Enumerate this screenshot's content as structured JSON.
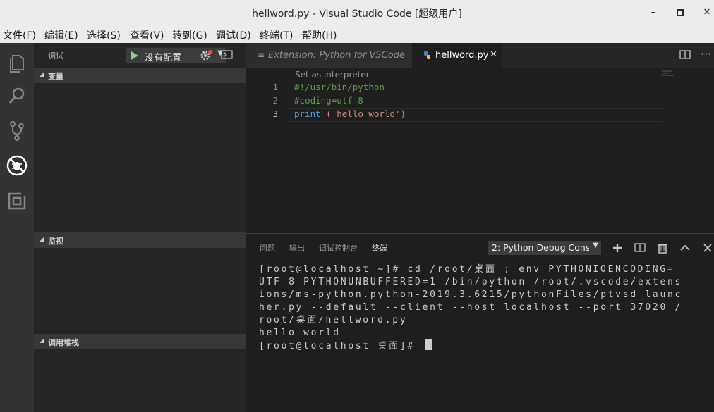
{
  "window": {
    "title": "hellword.py - Visual Studio Code [超级用户]",
    "minimize_glyph": "–",
    "maximize_glyph": "□",
    "close_glyph": "✕"
  },
  "menu": [
    "文件(F)",
    "编辑(E)",
    "选择(S)",
    "查看(V)",
    "转到(G)",
    "调试(D)",
    "终端(T)",
    "帮助(H)"
  ],
  "activity_bar": {
    "items": [
      "explorer-icon",
      "search-icon",
      "source-control-icon",
      "debug-icon",
      "extensions-icon"
    ],
    "active": "debug-icon",
    "bg_color": "#333333"
  },
  "sidebar": {
    "title": "调试",
    "config_select": "没有配置",
    "sections": {
      "variables": "变量",
      "watch": "监视",
      "call_stack": "调用堆栈"
    }
  },
  "editor": {
    "tabs": [
      {
        "label": "Extension: Python for VSCode",
        "icon": "≡",
        "active": false
      },
      {
        "label": "hellword.py",
        "icon": "python-icon",
        "active": true,
        "close": "✕"
      }
    ],
    "codelens": "Set as interpreter",
    "lines": [
      {
        "num": "1",
        "text": "#!/usr/bin/python",
        "kind": "comment"
      },
      {
        "num": "2",
        "text": "#coding=utf-8",
        "kind": "comment"
      },
      {
        "num": "3",
        "keyword": "print",
        "rest": " ('hello world')"
      }
    ],
    "more_glyph": "···"
  },
  "panel": {
    "tabs": [
      "问题",
      "输出",
      "调试控制台",
      "终端"
    ],
    "active_tab": "终端",
    "terminal_select": "2: Python Debug Console",
    "terminal_lines": [
      "[root@localhost ~]# cd /root/桌面 ; env PYTHONIOENCODING=",
      "UTF-8 PYTHONUNBUFFERED=1 /bin/python /root/.vscode/extens",
      "ions/ms-python.python-2019.3.6215/pythonFiles/ptvsd_launc",
      "her.py --default --client --host localhost --port 37020 /",
      "root/桌面/hellword.py",
      "hello world"
    ],
    "prompt": "[root@localhost 桌面]# "
  },
  "colors": {
    "accent_play": "#89d185",
    "comment": "#5d9d48",
    "keyword": "#569cd6",
    "string": "#ce9178"
  }
}
